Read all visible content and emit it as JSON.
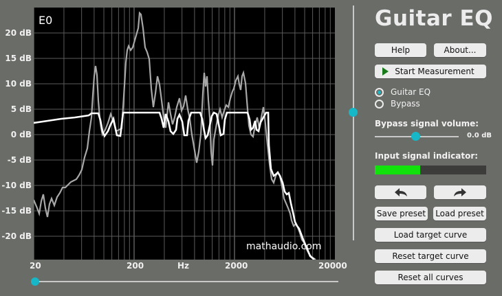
{
  "app": {
    "title": "Guitar EQ",
    "watermark": "mathaudio.com",
    "plot_label": "E0"
  },
  "y_axis": {
    "unit": "dB",
    "ticks": [
      "20 dB",
      "15 dB",
      "10 dB",
      "5 dB",
      "0 dB",
      "-5 dB",
      "-10 dB",
      "-15 dB",
      "-20 dB"
    ]
  },
  "x_axis": {
    "ticks": [
      "20",
      "200",
      "Hz",
      "2000",
      "20000"
    ]
  },
  "buttons": {
    "help": "Help",
    "about": "About...",
    "start_measurement": "Start Measurement",
    "save_preset": "Save preset",
    "load_preset": "Load preset",
    "load_target_curve": "Load target curve",
    "reset_target_curve": "Reset target curve",
    "reset_all_curves": "Reset all curves"
  },
  "mode": {
    "options": [
      "Guitar EQ",
      "Bypass"
    ],
    "selected": "Guitar EQ"
  },
  "bypass_volume": {
    "label": "Bypass signal volume:",
    "value_text": "0.0 dB"
  },
  "input_indicator": {
    "label": "Input signal indicator:",
    "level": 0.41
  },
  "icons": {
    "undo": "undo-arrow-icon",
    "redo": "redo-arrow-icon",
    "play": "play-icon"
  },
  "colors": {
    "background": "#6a6c67",
    "plot": "#000000",
    "accent": "#16b8c8",
    "meter": "#11e20b"
  }
}
